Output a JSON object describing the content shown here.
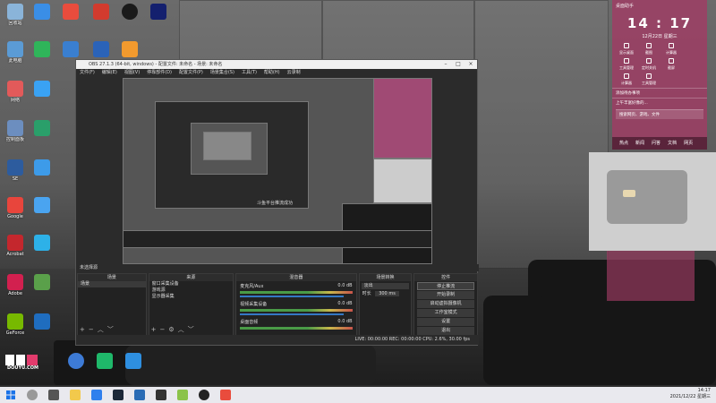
{
  "desktop_icons": [
    {
      "label": "回收站",
      "color": "#8ab4d9"
    },
    {
      "label": "此电脑",
      "color": "#5b9bd5"
    },
    {
      "label": "网络",
      "color": "#e25a5a"
    },
    {
      "label": "控制面板",
      "color": "#6c8ebf"
    },
    {
      "label": "SE",
      "color": "#2d5c9e"
    },
    {
      "label": "Google",
      "color": "#e8453c"
    },
    {
      "label": "Adobe",
      "color": "#d2204f"
    },
    {
      "label": "GeForce",
      "color": "#77b900"
    },
    {
      "label": "Acrobat",
      "color": "#c4272d"
    }
  ],
  "obs": {
    "title": "OBS 27.1.3 (64-bit, windows) - 配置文件: 未命名 - 场景: 未命名",
    "menu": [
      "文件(F)",
      "编辑(E)",
      "视图(V)",
      "停靠部件(D)",
      "配置文件(P)",
      "场景集合(S)",
      "工具(T)",
      "帮助(H)",
      "云录制"
    ],
    "preview_caption": "斗鱼平台推流成功",
    "preview_bar": "未选择源",
    "scenes_title": "场景",
    "scene_items": [
      "场景"
    ],
    "sources_title": "来源",
    "source_items": [
      "窗口采集设备",
      "游戏源",
      "显示器采集"
    ],
    "mixer_title": "混音器",
    "mixer_channels": [
      {
        "name": "麦克风/Aux",
        "db": "0.0 dB"
      },
      {
        "name": "视频采集设备",
        "db": "0.0 dB"
      },
      {
        "name": "桌面音频",
        "db": "0.0 dB"
      }
    ],
    "transition_title": "场景转换",
    "transition_type": "淡出",
    "duration_label": "时长",
    "duration_value": "300 ms",
    "controls_title": "控件",
    "controls": [
      "停止推流",
      "开始录制",
      "启动虚拟摄像机",
      "工作室模式",
      "设置",
      "退出"
    ],
    "status": "LIVE: 00:00:00  REC: 00:00:00  CPU: 2.6%, 30.00 fps"
  },
  "panel_right": {
    "header": "桌面助手",
    "time": "14 : 17",
    "date": "12月22日 星期三",
    "tools": [
      "显示桌面",
      "截图",
      "计算器",
      "工具管理",
      "定时关机",
      "截屏",
      "计算器",
      "工具管理"
    ],
    "line1": "添加待办事项",
    "line2": "上午丰富好像的...",
    "search_placeholder": "搜索网页、游戏、文件",
    "news_tabs": [
      "热点",
      "新闻",
      "问答",
      "文档",
      "网页"
    ]
  },
  "taskbar": {
    "time": "14:17",
    "date": "2021/12/22 星期三"
  },
  "logo_text": "DOUYU.COM"
}
